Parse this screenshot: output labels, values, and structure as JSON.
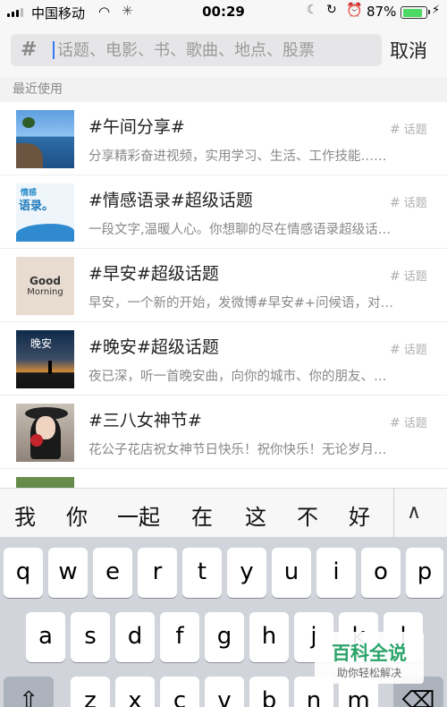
{
  "status_bar": {
    "carrier": "中国移动",
    "time": "00:29",
    "battery_percent": "87%",
    "battery_level": 0.87
  },
  "search": {
    "placeholder": "话题、电影、书、歌曲、地点、股票",
    "value": "",
    "cancel_label": "取消"
  },
  "section_label": "最近使用",
  "topics": [
    {
      "title": "#午间分享#",
      "description": "分享精彩奋进视频，实用学习、生活、工作技能……",
      "tag": "话题"
    },
    {
      "title": "#情感语录#超级话题",
      "description": "一段文字,温暖人心。你想聊的尽在情感语录超级话…",
      "tag": "话题"
    },
    {
      "title": "#早安#超级话题",
      "description": "早安，一个新的开始，发微博#早安#+问候语，对…",
      "tag": "话题"
    },
    {
      "title": "#晚安#超级话题",
      "description": "夜已深，听一首晚安曲，向你的城市、你的朋友、…",
      "tag": "话题"
    },
    {
      "title": "#三八女神节#",
      "description": "花公子花店祝女神节日快乐！祝你快乐！无论岁月…",
      "tag": "话题"
    }
  ],
  "thumb_text": {
    "t2a": "情感",
    "t2b": "语录。",
    "t3a": "Good",
    "t3b": "Morning",
    "t4a": "晚安"
  },
  "candidates": [
    "我",
    "你",
    "一起",
    "在",
    "这",
    "不",
    "好"
  ],
  "keyboard": {
    "row1": [
      "q",
      "w",
      "e",
      "r",
      "t",
      "y",
      "u",
      "i",
      "o",
      "p"
    ],
    "row2": [
      "a",
      "s",
      "d",
      "f",
      "g",
      "h",
      "j",
      "k",
      "l"
    ],
    "row3": [
      "z",
      "x",
      "c",
      "v",
      "b",
      "n",
      "m"
    ]
  },
  "watermark": {
    "title": "百科全说",
    "subtitle": "助你轻松解决"
  }
}
